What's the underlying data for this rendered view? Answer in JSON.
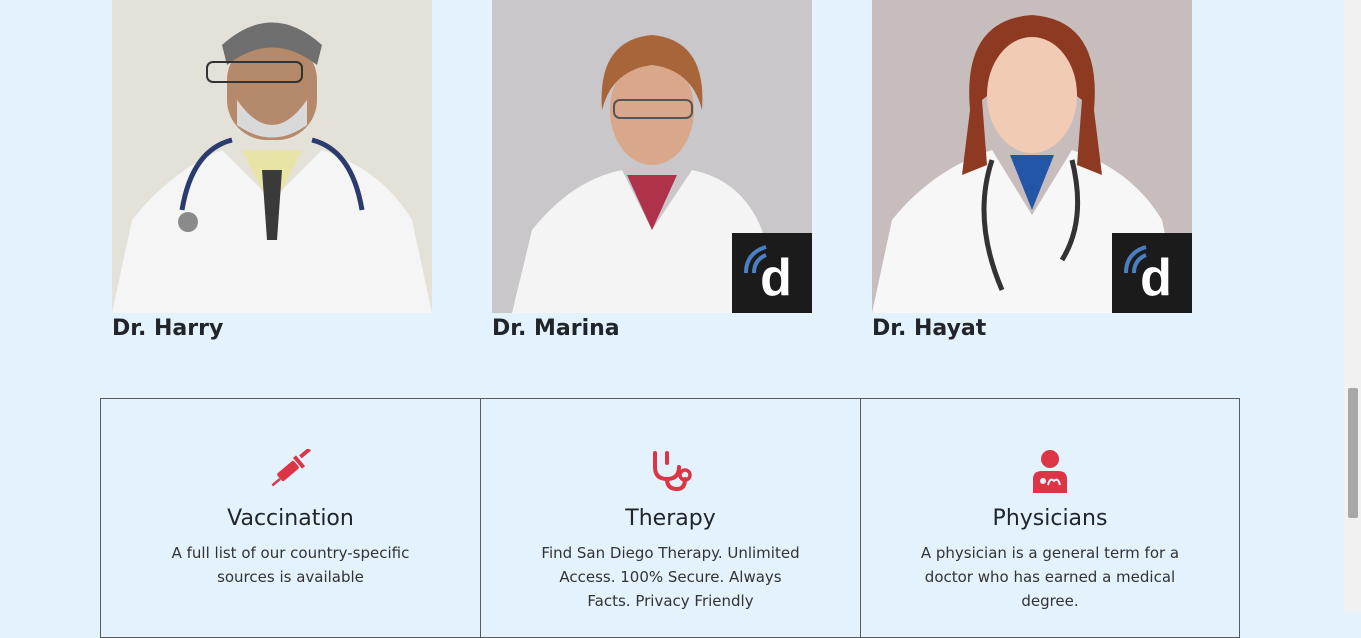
{
  "doctors": [
    {
      "name": "Dr. Harry"
    },
    {
      "name": "Dr. Marina",
      "badge_letter": "d"
    },
    {
      "name": "Dr. Hayat",
      "badge_letter": "d"
    }
  ],
  "services": [
    {
      "icon": "syringe-icon",
      "title": "Vaccination",
      "description": "A full list of our country-specific sources is available"
    },
    {
      "icon": "stethoscope-icon",
      "title": "Therapy",
      "description": "Find San Diego Therapy. Unlimited Access. 100% Secure. Always Facts. Privacy Friendly"
    },
    {
      "icon": "user-doctor-icon",
      "title": "Physicians",
      "description": "A physician is a general term for a doctor who has earned a medical degree."
    }
  ],
  "colors": {
    "background": "#e3f2fd",
    "accent": "#dc3545",
    "text": "#212529"
  }
}
